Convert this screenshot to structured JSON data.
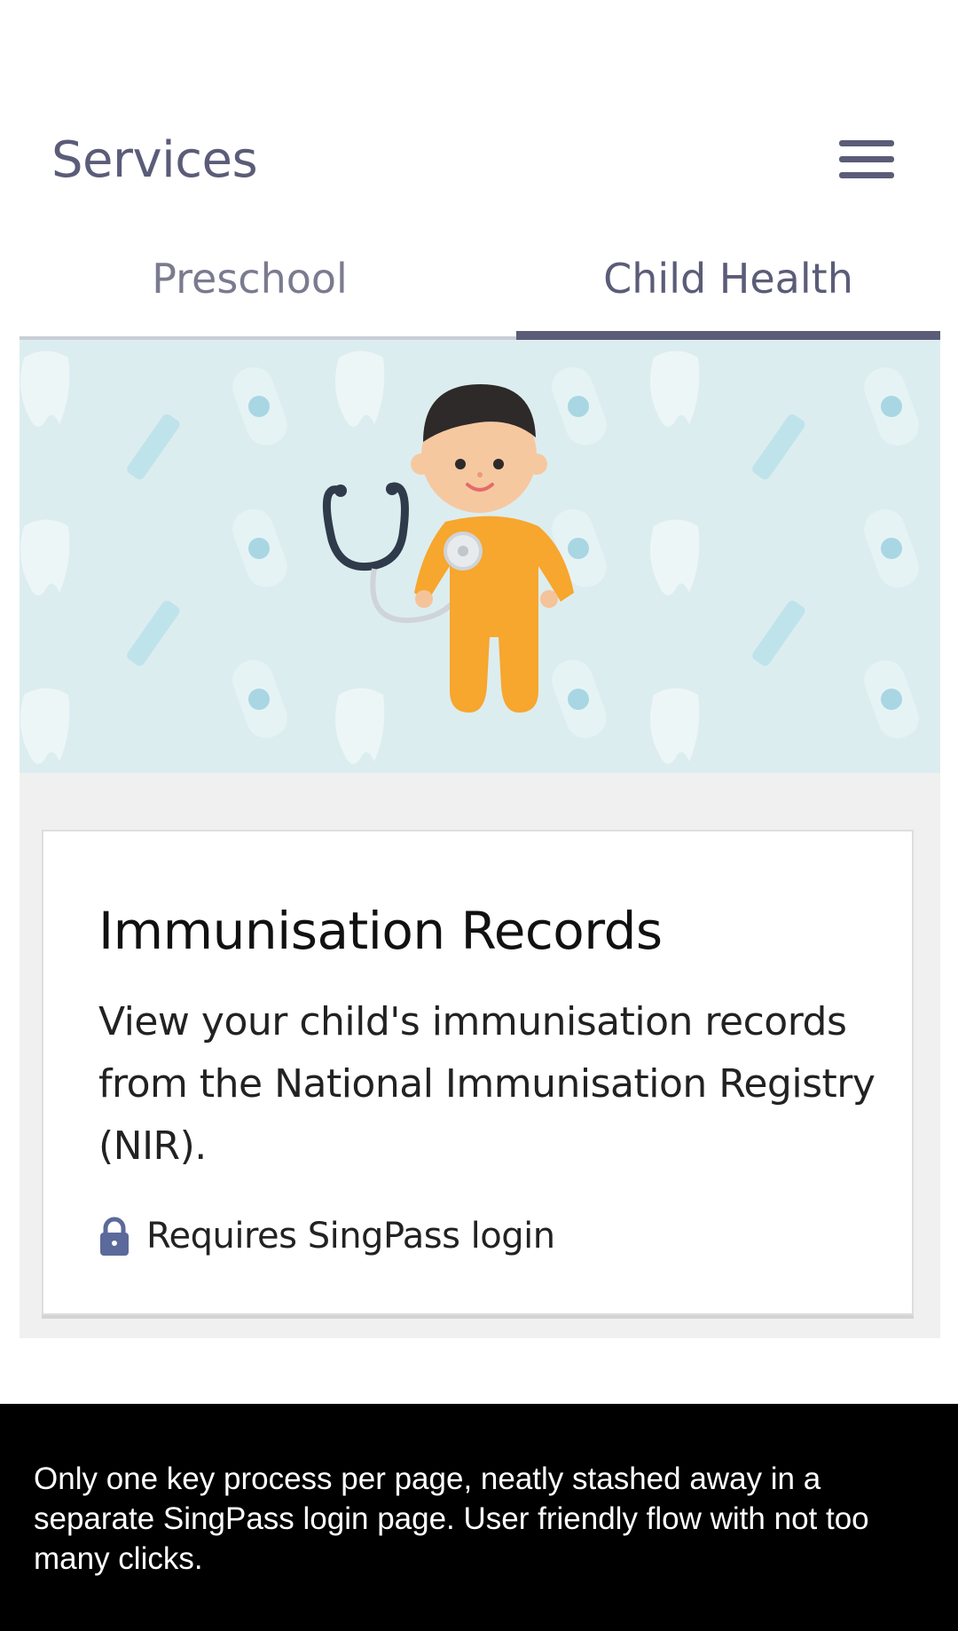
{
  "header": {
    "title": "Services"
  },
  "tabs": [
    {
      "label": "Preschool",
      "selected": false
    },
    {
      "label": "Child Health",
      "selected": true
    }
  ],
  "banner": {
    "illustration": "baby-with-stethoscope-illustration"
  },
  "card": {
    "title": "Immunisation Records",
    "description": "View your child's immunisation records from the National Immunisation Registry (NIR).",
    "login_note": "Requires SingPass login",
    "lock_icon": "lock-icon"
  },
  "caption": {
    "text": "Only one key process per page, neatly stashed away in a separate SingPass login page. User friendly flow with not too many clicks."
  },
  "colors": {
    "accent": "#5b5c78",
    "banner_bg": "#dcedf0",
    "baby_suit": "#f7a62e"
  }
}
